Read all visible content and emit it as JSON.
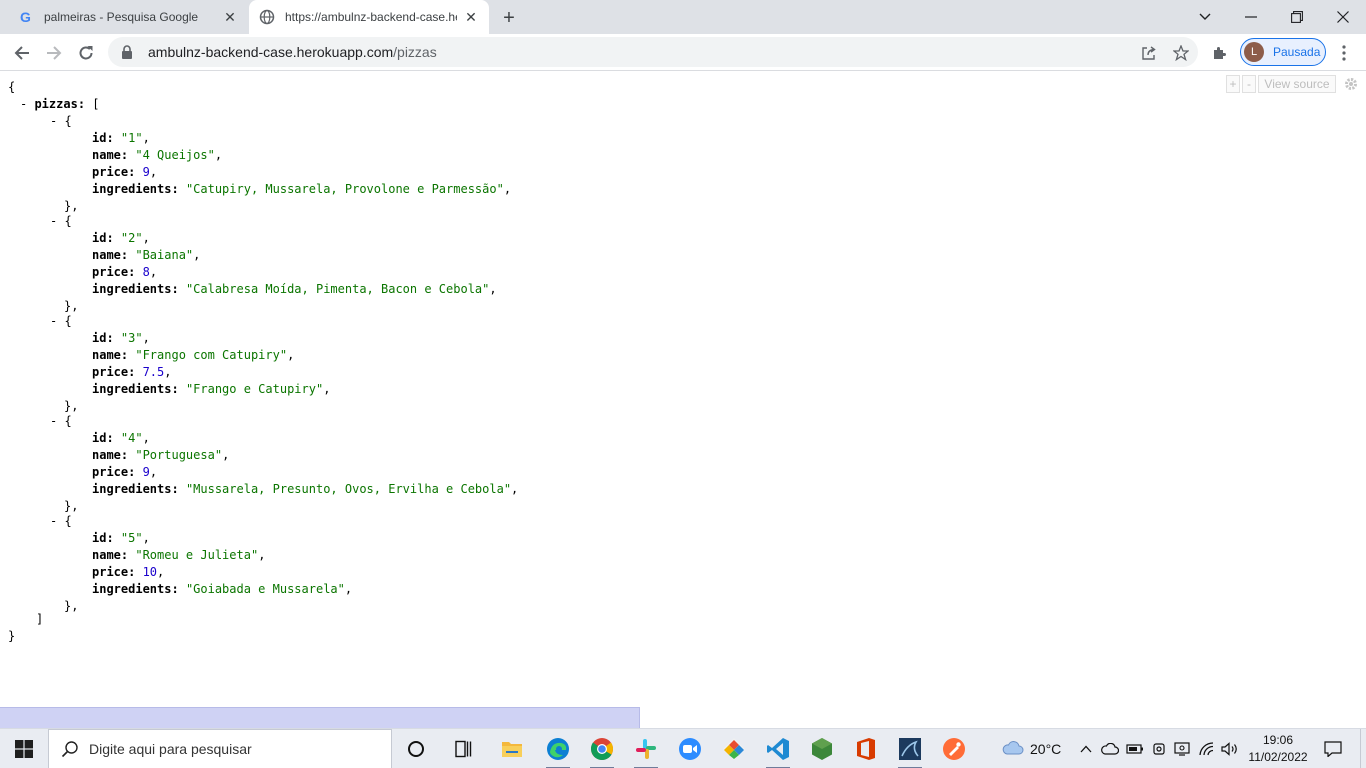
{
  "browser": {
    "tabs": [
      {
        "title": "palmeiras - Pesquisa Google",
        "icon": "google-icon"
      },
      {
        "title": "https://ambulnz-backend-case.herokuapp.com/pizzas",
        "icon": "globe-icon"
      }
    ],
    "address": {
      "host": "ambulnz-backend-case.herokuapp.com",
      "path": "/pizzas"
    },
    "profile": {
      "initial": "L",
      "label": "Pausada"
    }
  },
  "viewer_tools": {
    "plus": "+",
    "minus": "-",
    "view_source": "View source"
  },
  "json_view": {
    "root_key": "pizzas",
    "fields": [
      "id",
      "name",
      "price",
      "ingredients"
    ],
    "items": [
      {
        "id": "\"1\"",
        "name": "\"4 Queijos\"",
        "price": "9",
        "ingredients": "\"Catupiry, Mussarela, Provolone e Parmessão\""
      },
      {
        "id": "\"2\"",
        "name": "\"Baiana\"",
        "price": "8",
        "ingredients": "\"Calabresa Moída, Pimenta, Bacon e Cebola\""
      },
      {
        "id": "\"3\"",
        "name": "\"Frango com Catupiry\"",
        "price": "7.5",
        "ingredients": "\"Frango e Catupiry\""
      },
      {
        "id": "\"4\"",
        "name": "\"Portuguesa\"",
        "price": "9",
        "ingredients": "\"Mussarela, Presunto, Ovos, Ervilha e Cebola\""
      },
      {
        "id": "\"5\"",
        "name": "\"Romeu e Julieta\"",
        "price": "10",
        "ingredients": "\"Goiabada e Mussarela\""
      }
    ]
  },
  "taskbar": {
    "search_placeholder": "Digite aqui para pesquisar",
    "apps": [
      "task-view-icon",
      "widgets-icon",
      "file-explorer-icon",
      "edge-icon",
      "chrome-icon",
      "slack-icon",
      "zoom-icon",
      "git-icon",
      "vscode-icon",
      "nodejs-icon",
      "office-icon",
      "mysql-workbench-icon",
      "postman-icon"
    ],
    "weather": "20°C",
    "time": "19:06",
    "date": "11/02/2022"
  },
  "colors": {
    "string": "#0b7500",
    "number": "#1a01cc",
    "accent": "#1a73e8"
  }
}
